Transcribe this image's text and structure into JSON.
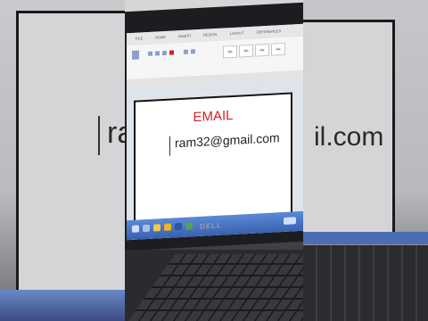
{
  "document": {
    "heading": "EMAIL",
    "email": "ram32@gmail.com"
  },
  "background": {
    "right_fragment": "il.com"
  },
  "brand": "DELL",
  "colors": {
    "heading_red": "#d21f26",
    "taskbar_blue": "#3861b0"
  }
}
